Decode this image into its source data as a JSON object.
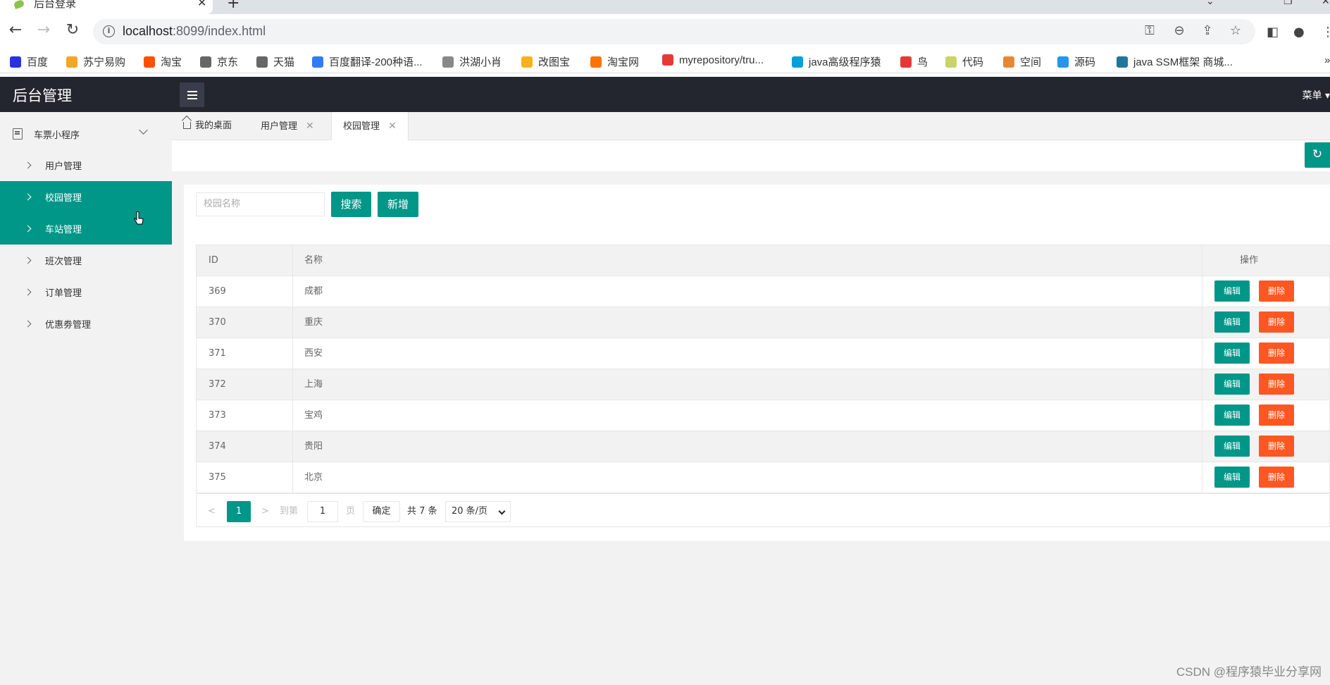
{
  "browser": {
    "tab_title": "后台登录",
    "url_host": "localhost",
    "url_rest": ":8099/index.html",
    "bookmarks": [
      {
        "label": "百度",
        "color": "#2932e1"
      },
      {
        "label": "苏宁易购",
        "color": "#f5a623"
      },
      {
        "label": "淘宝",
        "color": "#ff5000"
      },
      {
        "label": "京东",
        "color": "#666666"
      },
      {
        "label": "天猫",
        "color": "#666666"
      },
      {
        "label": "百度翻译-200种语...",
        "color": "#2f7cf6"
      },
      {
        "label": "洪湖小肖",
        "color": "#888888"
      },
      {
        "label": "改图宝",
        "color": "#f6b21b"
      },
      {
        "label": "淘宝网",
        "color": "#ff7300"
      },
      {
        "label": "myrepository/tru...",
        "color": "#e53935"
      },
      {
        "label": "java高级程序猿",
        "color": "#00a1d6"
      },
      {
        "label": "鸟",
        "color": "#e53935"
      },
      {
        "label": "代码",
        "color": "#c9d36b"
      },
      {
        "label": "空间",
        "color": "#e2883a"
      },
      {
        "label": "源码",
        "color": "#2496ed"
      },
      {
        "label": "java SSM框架 商城...",
        "color": "#21759b"
      }
    ]
  },
  "header": {
    "title": "后台管理",
    "menu_label": "菜单"
  },
  "sidebar": {
    "group_label": "车票小程序",
    "items": [
      {
        "label": "用户管理",
        "active": false
      },
      {
        "label": "校园管理",
        "active": true
      },
      {
        "label": "车站管理",
        "active": true
      },
      {
        "label": "班次管理",
        "active": false
      },
      {
        "label": "订单管理",
        "active": false
      },
      {
        "label": "优惠劵管理",
        "active": false
      }
    ]
  },
  "page_tabs": [
    {
      "label": "我的桌面",
      "closable": false,
      "active": false
    },
    {
      "label": "用户管理",
      "closable": true,
      "active": false
    },
    {
      "label": "校园管理",
      "closable": true,
      "active": true
    }
  ],
  "search": {
    "placeholder": "校园名称",
    "search_label": "搜索",
    "add_label": "新增"
  },
  "table": {
    "headers": {
      "id": "ID",
      "name": "名称",
      "ops": "操作"
    },
    "edit_label": "编辑",
    "delete_label": "删除",
    "rows": [
      {
        "id": "369",
        "name": "成都"
      },
      {
        "id": "370",
        "name": "重庆"
      },
      {
        "id": "371",
        "name": "西安"
      },
      {
        "id": "372",
        "name": "上海"
      },
      {
        "id": "373",
        "name": "宝鸡"
      },
      {
        "id": "374",
        "name": "贵阳"
      },
      {
        "id": "375",
        "name": "北京"
      }
    ]
  },
  "pager": {
    "current": "1",
    "goto_label": "到第",
    "goto_value": "1",
    "page_unit": "页",
    "ok_label": "确定",
    "total": "共 7 条",
    "page_size": "20 条/页"
  },
  "watermark": "CSDN @程序猿毕业分享网",
  "colors": {
    "accent": "#009688",
    "danger": "#ff5722",
    "header_bg": "#23262e"
  }
}
